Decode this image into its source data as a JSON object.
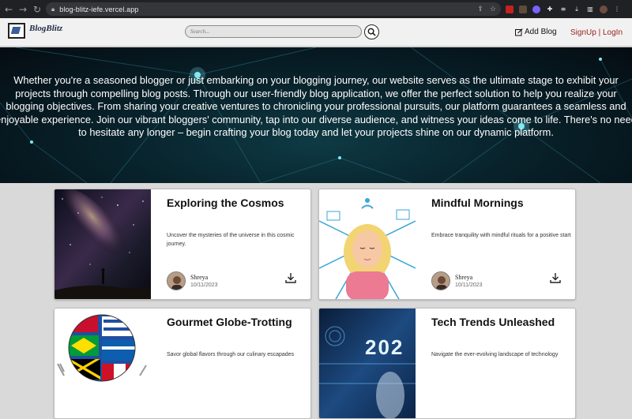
{
  "browser": {
    "url": "blog-blitz-iefe.vercel.app",
    "nav": [
      "back-icon",
      "forward-icon",
      "reload-icon"
    ],
    "omnibox_icons": [
      "share-icon",
      "star-icon"
    ],
    "extensions": [
      "pdf-extension-icon",
      "extension-icon",
      "extension-icon",
      "puzzle-icon",
      "media-icon",
      "download-icon",
      "sidebar-icon",
      "profile-avatar",
      "menu-icon"
    ]
  },
  "header": {
    "logo_text": "BlogBlitz",
    "search_placeholder": "Search...",
    "add_blog_label": "Add Blog",
    "signup_label": "SignUp",
    "separator": "|",
    "login_label": "LogIn"
  },
  "hero": {
    "text": "Whether you're a seasoned blogger or just embarking on your blogging journey, our website serves as the ultimate stage to exhibit your projects through compelling blog posts. Through our user-friendly blog application, we offer the perfect solution to help you realize your blogging objectives. From sharing your creative ventures to chronicling your professional pursuits, our platform guarantees a seamless and enjoyable experience. Join our vibrant bloggers' community, tap into our diverse audience, and witness your ideas come to life. There's no need to hesitate any longer – begin crafting your blog today and let your projects shine on our dynamic platform."
  },
  "posts": [
    {
      "title": "Exploring the Cosmos",
      "description": "Uncover the mysteries of the universe in this cosmic journey.",
      "author": "Shreya",
      "date": "10/11/2023",
      "image": "starry-sky-image"
    },
    {
      "title": "Mindful Mornings",
      "description": "Embrace tranquility with mindful rituals for a positive start",
      "author": "Shreya",
      "date": "10/11/2023",
      "image": "meditation-illustration"
    },
    {
      "title": "Gourmet Globe-Trotting",
      "description": "Savor global flavors through our culinary escapades",
      "author": "",
      "date": "",
      "image": "flag-globe-image"
    },
    {
      "title": "Tech Trends Unleashed",
      "description": "Navigate the ever-evolving landscape of technology",
      "author": "",
      "date": "",
      "image": "tech-2023-image"
    }
  ],
  "colors": {
    "auth_red": "#9b1c1c",
    "hero_bg": "#08222b",
    "page_bg": "#d9d9d9",
    "chrome_bg": "#202124"
  }
}
